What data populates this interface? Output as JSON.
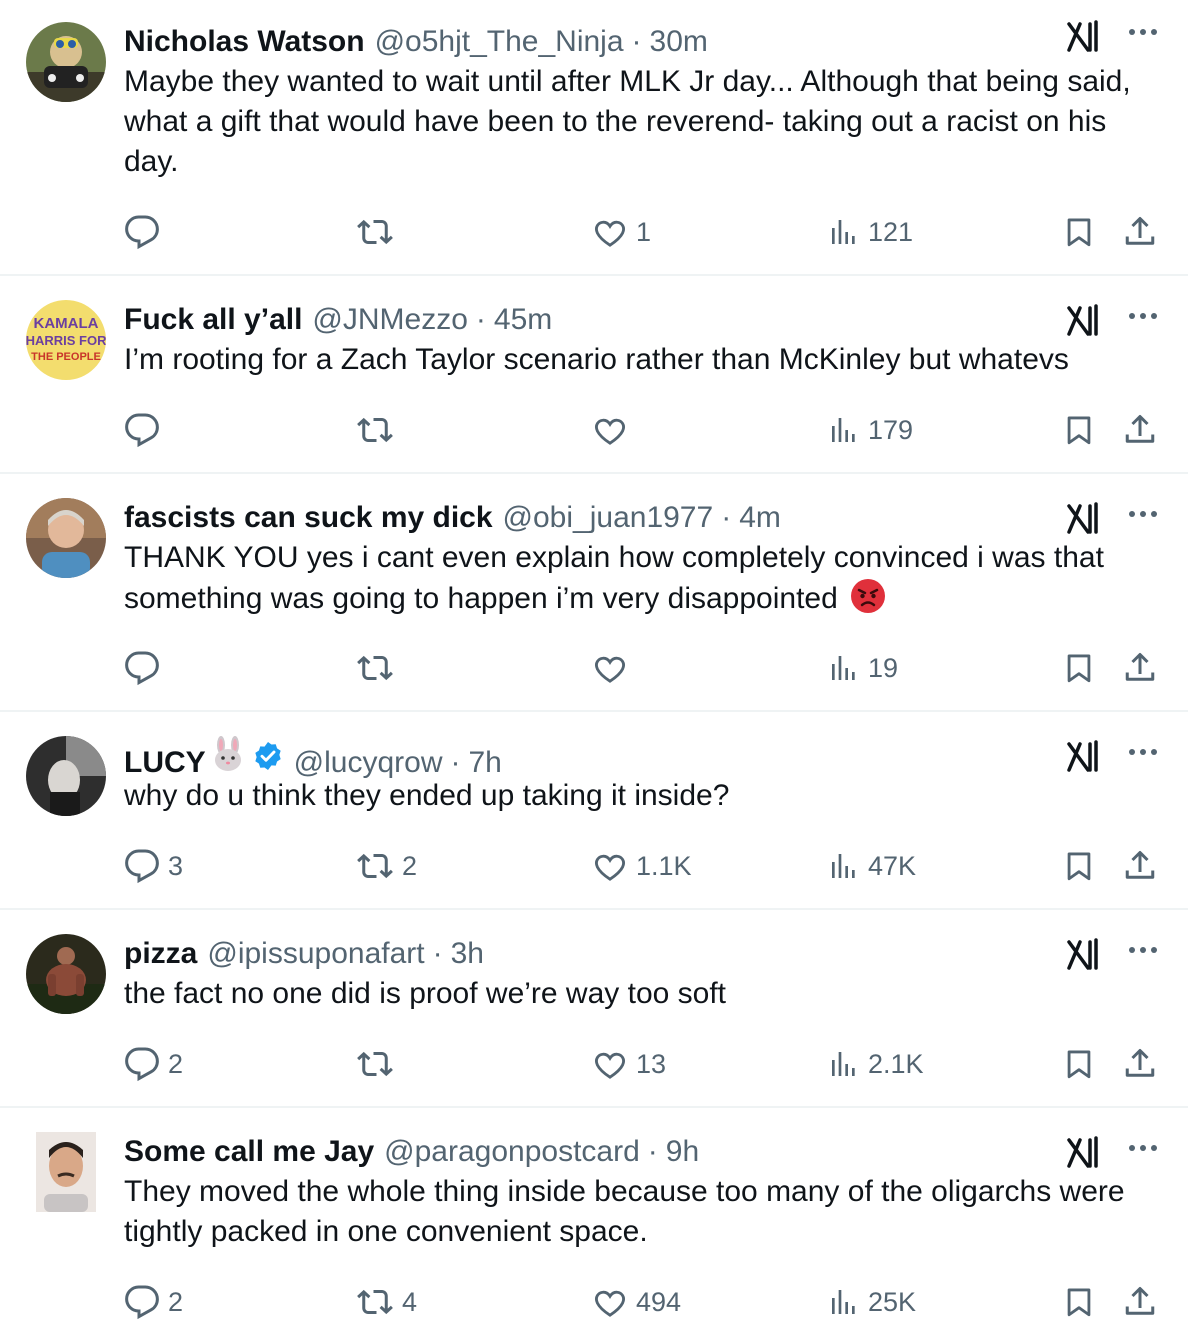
{
  "tweets": [
    {
      "name": "Nicholas Watson",
      "handle": "@o5hjt_The_Ninja",
      "time": "30m",
      "text": "Maybe they wanted to wait until after MLK Jr day... Although that being said, what a gift that would have been to the reverend- taking out a racist on his day.",
      "replies": "",
      "reposts": "",
      "likes": "1",
      "views": "121",
      "avatar_icon": "ninja-avatar"
    },
    {
      "name": "Fuck all y’all",
      "handle": "@JNMezzo",
      "time": "45m",
      "text": "I’m rooting for a Zach Taylor scenario rather than McKinley but whatevs",
      "replies": "",
      "reposts": "",
      "likes": "",
      "views": "179",
      "avatar_text": [
        "KAMALA",
        "HARRIS FOR",
        "THE PEOPLE"
      ]
    },
    {
      "name": "fascists can suck my dick",
      "handle": "@obi_juan1977",
      "time": "4m",
      "text": "THANK YOU yes i cant even explain how completely convinced i was that something was going to happen i’m very disappointed",
      "text_emoji": "angry-face-emoji",
      "replies": "",
      "reposts": "",
      "likes": "",
      "views": "19",
      "avatar_icon": "woman-photo-avatar"
    },
    {
      "name": "LUCY",
      "name_emoji": "rabbit-face-emoji",
      "verified": true,
      "handle": "@lucyqrow",
      "time": "7h",
      "text": "why do u think they ended up taking it inside?",
      "replies": "3",
      "reposts": "2",
      "likes": "1.1K",
      "views": "47K",
      "avatar_icon": "dark-photo-avatar"
    },
    {
      "name": "pizza",
      "handle": "@ipissuponafart",
      "time": "3h",
      "text": "the fact no one did is proof we’re way too soft",
      "replies": "2",
      "reposts": "",
      "likes": "13",
      "views": "2.1K",
      "avatar_icon": "figure-photo-avatar"
    },
    {
      "name": "Some call me Jay",
      "handle": "@paragonpostcard",
      "time": "9h",
      "text": "They moved the whole thing inside because too many of the oligarchs were tightly packed in one convenient space.",
      "replies": "2",
      "reposts": "4",
      "likes": "494",
      "views": "25K",
      "avatar_icon": "man-photo-avatar"
    }
  ],
  "separator": "·",
  "colors": {
    "text": "#0f1419",
    "secondary": "#536471",
    "divider": "#eff3f4",
    "verified": "#1d9bf0",
    "angry": "#e0303b"
  }
}
